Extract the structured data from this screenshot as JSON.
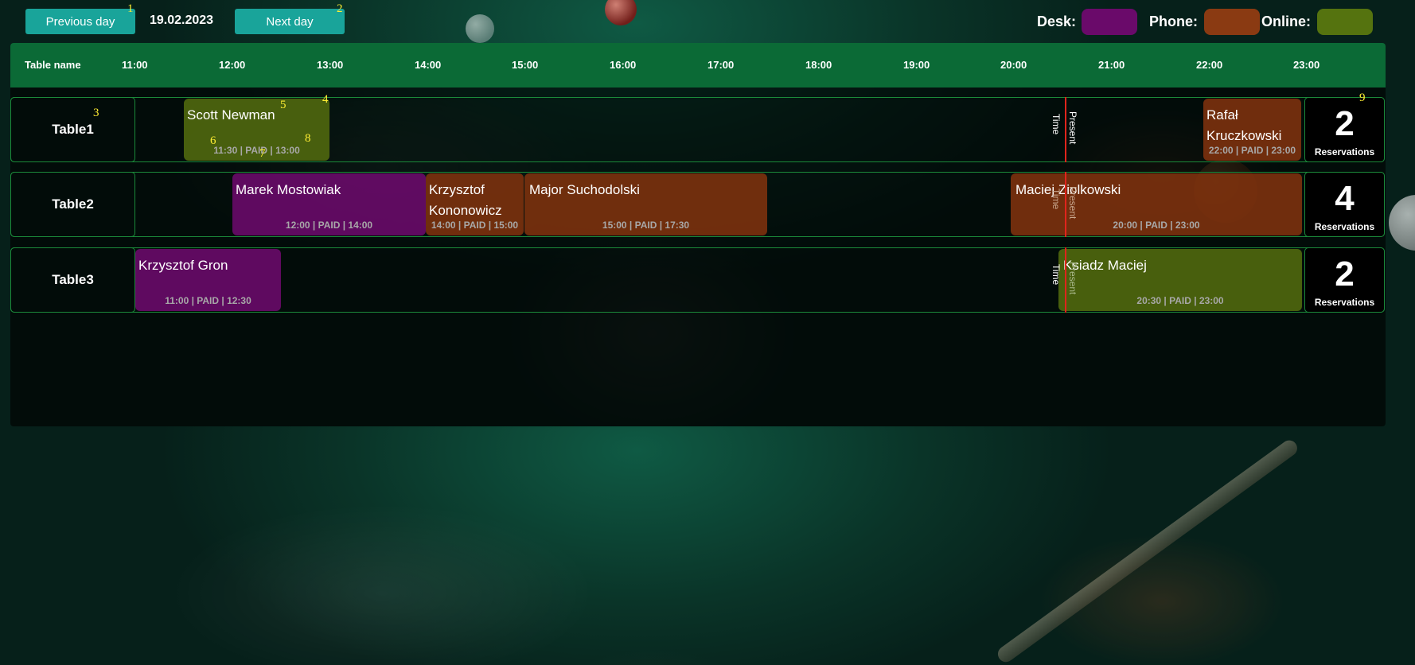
{
  "toolbar": {
    "prev_label": "Previous day",
    "next_label": "Next day",
    "date": "19.02.2023"
  },
  "legend": [
    {
      "label": "Desk:",
      "color": "#6a0a6a"
    },
    {
      "label": "Phone:",
      "color": "#8a3a12"
    },
    {
      "label": "Online:",
      "color": "#55730f"
    }
  ],
  "header": {
    "table_name": "Table name",
    "hours": [
      "11:00",
      "12:00",
      "13:00",
      "14:00",
      "15:00",
      "16:00",
      "17:00",
      "18:00",
      "19:00",
      "20:00",
      "21:00",
      "22:00",
      "23:00"
    ]
  },
  "present_time_label": [
    "Present",
    "Time"
  ],
  "tables": [
    {
      "name": "Table1",
      "count": "2",
      "count_label": "Reservations",
      "bookings": [
        {
          "name": "Scott Newman",
          "info": "11:30 | PAID | 13:00",
          "channel": "online"
        },
        {
          "name": "Rafał Kruczkowski",
          "info": "22:00 | PAID | 23:00",
          "channel": "phone"
        }
      ]
    },
    {
      "name": "Table2",
      "count": "4",
      "count_label": "Reservations",
      "bookings": [
        {
          "name": "Marek Mostowiak",
          "info": "12:00 | PAID | 14:00",
          "channel": "desk"
        },
        {
          "name": "Krzysztof Kononowicz",
          "info": "14:00 | PAID | 15:00",
          "channel": "phone"
        },
        {
          "name": "Major Suchodolski",
          "info": "15:00 | PAID | 17:30",
          "channel": "phone"
        },
        {
          "name": "Maciej Ziolkowski",
          "info": "20:00 | PAID | 23:00",
          "channel": "phone"
        }
      ]
    },
    {
      "name": "Table3",
      "count": "2",
      "count_label": "Reservations",
      "bookings": [
        {
          "name": "Krzysztof Gron",
          "info": "11:00 | PAID | 12:30",
          "channel": "desk"
        },
        {
          "name": "Ksiadz Maciej",
          "info": "20:30 | PAID | 23:00",
          "channel": "online"
        }
      ]
    }
  ],
  "annotations": [
    "1",
    "2",
    "3",
    "4",
    "5",
    "6",
    "7",
    "8",
    "9"
  ]
}
